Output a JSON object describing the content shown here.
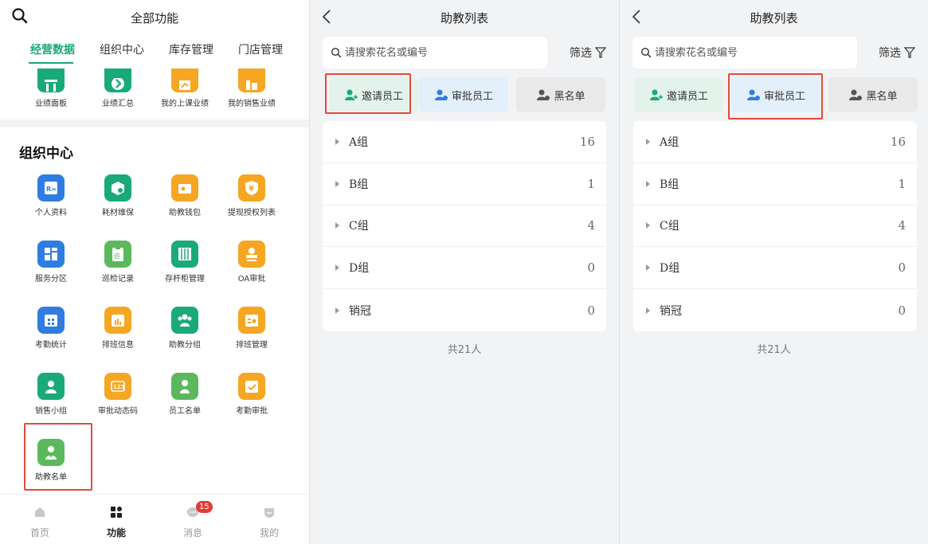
{
  "panel1": {
    "header_title": "全部功能",
    "tabs": [
      {
        "label": "经营数据"
      },
      {
        "label": "组织中心"
      },
      {
        "label": "库存管理"
      },
      {
        "label": "门店管理"
      }
    ],
    "cut_row": [
      {
        "label": "业绩面板",
        "icon": "chart-icon",
        "color": "#1aa97b"
      },
      {
        "label": "业绩汇总",
        "icon": "arrow-icon",
        "color": "#1aa97b"
      },
      {
        "label": "我的上课业绩",
        "icon": "class-icon",
        "color": "#f5a623"
      },
      {
        "label": "我的销售业绩",
        "icon": "sales-icon",
        "color": "#f5a623"
      }
    ],
    "section_title": "组织中心",
    "grid": [
      {
        "label": "个人资料",
        "icon": "id-card-icon",
        "color": "#2f7de1"
      },
      {
        "label": "耗材维保",
        "icon": "box-icon",
        "color": "#1aa97b"
      },
      {
        "label": "助教钱包",
        "icon": "wallet-icon",
        "color": "#f5a623"
      },
      {
        "label": "提现授权列表",
        "icon": "shield-yen-icon",
        "color": "#f5a623"
      },
      {
        "label": "服务分区",
        "icon": "layout-icon",
        "color": "#2f7de1"
      },
      {
        "label": "巡检记录",
        "icon": "clipboard-icon",
        "color": "#5cb85c"
      },
      {
        "label": "存杆柜管理",
        "icon": "cabinet-icon",
        "color": "#1aa97b"
      },
      {
        "label": "OA审批",
        "icon": "stamp-icon",
        "color": "#f5a623"
      },
      {
        "label": "考勤统计",
        "icon": "calendar-icon",
        "color": "#2f7de1"
      },
      {
        "label": "排班信息",
        "icon": "schedule-icon",
        "color": "#f5a623"
      },
      {
        "label": "助教分组",
        "icon": "group-icon",
        "color": "#1aa97b"
      },
      {
        "label": "排班管理",
        "icon": "schedule-user-icon",
        "color": "#f5a623"
      },
      {
        "label": "销售小组",
        "icon": "user-icon",
        "color": "#1aa97b"
      },
      {
        "label": "审批动态码",
        "icon": "code-icon",
        "color": "#f5a623"
      },
      {
        "label": "员工名单",
        "icon": "employee-icon",
        "color": "#5cb85c"
      },
      {
        "label": "考勤审批",
        "icon": "calendar-check-icon",
        "color": "#f5a623"
      },
      {
        "label": "助教名单",
        "icon": "assistant-icon",
        "color": "#5cb85c"
      }
    ],
    "nav": [
      {
        "label": "首页",
        "icon": "home-icon"
      },
      {
        "label": "功能",
        "icon": "apps-icon"
      },
      {
        "label": "消息",
        "icon": "message-icon",
        "badge": "15"
      },
      {
        "label": "我的",
        "icon": "profile-icon"
      }
    ],
    "highlight_color": "#e5493a"
  },
  "list": {
    "title": "助教列表",
    "search_placeholder": "请搜索花名或编号",
    "filter_label": "筛选",
    "actions": {
      "invite": "邀请员工",
      "approve": "审批员工",
      "blacklist": "黑名单"
    },
    "groups": [
      {
        "name": "A组",
        "count": "16"
      },
      {
        "name": "B组",
        "count": "1"
      },
      {
        "name": "C组",
        "count": "4"
      },
      {
        "name": "D组",
        "count": "0"
      },
      {
        "name": "销冠",
        "count": "0"
      }
    ],
    "total": "共21人"
  },
  "colors": {
    "brand_green": "#1aa97b",
    "highlight_red": "#e5493a",
    "badge_red": "#e53935"
  }
}
